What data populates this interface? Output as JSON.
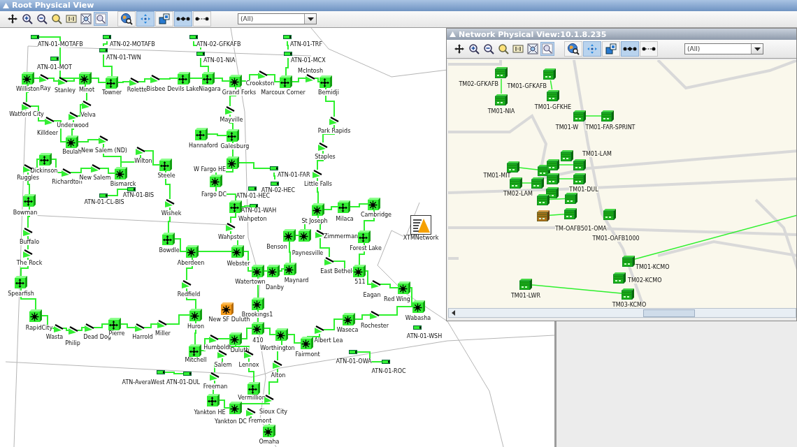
{
  "main_window": {
    "title": "Root Physical View",
    "toolbar": {
      "tools": [
        {
          "kind": "pan",
          "selected": false
        },
        {
          "kind": "zoom-in",
          "selected": false
        },
        {
          "kind": "zoom-out",
          "selected": false
        },
        {
          "kind": "zoom-area",
          "selected": false
        },
        {
          "kind": "actual-size",
          "selected": false
        },
        {
          "kind": "fit",
          "selected": false
        },
        {
          "kind": "zoom-window",
          "selected": true
        },
        {
          "kind": "globe-search",
          "selected": false
        },
        {
          "kind": "move",
          "selected": true
        },
        {
          "kind": "layout",
          "selected": false
        },
        {
          "kind": "bundled-links",
          "selected": true
        },
        {
          "kind": "single-link",
          "selected": false
        }
      ],
      "filter": "(All)"
    },
    "map": {
      "nodes": [
        {
          "kind": "terminal",
          "label": "ATN-01-MOTAFB",
          "alarm": false
        },
        {
          "kind": "terminal",
          "label": "ATN-02-MOTAFB",
          "alarm": false
        },
        {
          "kind": "terminal",
          "label": "ATN-02-GFKAFB",
          "alarm": false
        },
        {
          "kind": "terminal",
          "label": "ATN-01-TRF",
          "alarm": false
        },
        {
          "kind": "terminal",
          "label": "ATN-01-TWN",
          "alarm": false
        },
        {
          "kind": "terminal",
          "label": "ATN-01-NIA",
          "alarm": false
        },
        {
          "kind": "terminal",
          "label": "ATN-01-MCX",
          "alarm": false
        },
        {
          "kind": "terminal",
          "label": "ATN-01-MOT",
          "alarm": false
        },
        {
          "kind": "hub",
          "label": "Williston",
          "alarm": false
        },
        {
          "kind": "radio",
          "label": "Ray",
          "alarm": false
        },
        {
          "kind": "radio",
          "label": "Stanley",
          "alarm": false
        },
        {
          "kind": "hub",
          "label": "Minot",
          "alarm": false
        },
        {
          "kind": "router",
          "label": "Towner",
          "alarm": false
        },
        {
          "kind": "radio",
          "label": "Rolette",
          "alarm": false
        },
        {
          "kind": "radio",
          "label": "Bisbee",
          "alarm": false
        },
        {
          "kind": "router",
          "label": "Devils Lake",
          "alarm": false
        },
        {
          "kind": "router",
          "label": "Niagara",
          "alarm": false
        },
        {
          "kind": "hub",
          "label": "Grand Forks",
          "alarm": false
        },
        {
          "kind": "radio",
          "label": "Crookston",
          "alarm": false
        },
        {
          "kind": "router",
          "label": "Marcoux Corner",
          "alarm": false
        },
        {
          "kind": "radio",
          "label": "McIntosh",
          "alarm": false
        },
        {
          "kind": "router",
          "label": "Bemidji",
          "alarm": false
        },
        {
          "kind": "radio",
          "label": "Watford City",
          "alarm": false
        },
        {
          "kind": "radio",
          "label": "Velva",
          "alarm": false
        },
        {
          "kind": "radio",
          "label": "Underwood",
          "alarm": false
        },
        {
          "kind": "radio",
          "label": "Killdeer",
          "alarm": false
        },
        {
          "kind": "radio",
          "label": "Mayville",
          "alarm": false
        },
        {
          "kind": "radio",
          "label": "Park Rapids",
          "alarm": false
        },
        {
          "kind": "hub",
          "label": "Beulah",
          "alarm": false
        },
        {
          "kind": "radio",
          "label": "New Salem (ND)",
          "alarm": false
        },
        {
          "kind": "router",
          "label": "Hannaford",
          "alarm": false
        },
        {
          "kind": "router",
          "label": "Galesburg",
          "alarm": false
        },
        {
          "kind": "radio",
          "label": "Wilton",
          "alarm": false
        },
        {
          "kind": "radio",
          "label": "Staples",
          "alarm": false
        },
        {
          "kind": "router",
          "label": "Dickinson",
          "alarm": false
        },
        {
          "kind": "hub",
          "label": "W Fargo HE",
          "alarm": false
        },
        {
          "kind": "radio",
          "label": "Ruggles",
          "alarm": false
        },
        {
          "kind": "radio",
          "label": "Richardton",
          "alarm": false
        },
        {
          "kind": "radio",
          "label": "New Salem",
          "alarm": false
        },
        {
          "kind": "hub",
          "label": "Bismarck",
          "alarm": false
        },
        {
          "kind": "router",
          "label": "Steele",
          "alarm": false
        },
        {
          "kind": "terminal",
          "label": "ATN-01-FAR",
          "alarm": false
        },
        {
          "kind": "radio",
          "label": "Little Falls",
          "alarm": false
        },
        {
          "kind": "terminal",
          "label": "ATN-01-BIS",
          "alarm": false
        },
        {
          "kind": "hub",
          "label": "Fargo DC",
          "alarm": false
        },
        {
          "kind": "terminal",
          "label": "ATN-02-HEC",
          "alarm": false
        },
        {
          "kind": "terminal",
          "label": "ATN-01-HEC",
          "alarm": false
        },
        {
          "kind": "terminal",
          "label": "ATN-01-CL-BIS",
          "alarm": false
        },
        {
          "kind": "router",
          "label": "Bowman",
          "alarm": false
        },
        {
          "kind": "radio",
          "label": "Wishek",
          "alarm": false
        },
        {
          "kind": "terminal",
          "label": "ATN-01-WAH",
          "alarm": false
        },
        {
          "kind": "router",
          "label": "Wahpeton",
          "alarm": false
        },
        {
          "kind": "hub",
          "label": "St Joseph",
          "alarm": false
        },
        {
          "kind": "router",
          "label": "Milaca",
          "alarm": false
        },
        {
          "kind": "hub",
          "label": "Cambridge",
          "alarm": false
        },
        {
          "kind": "radio",
          "label": "Buffalo",
          "alarm": false
        },
        {
          "kind": "radio",
          "label": "Wahpster",
          "alarm": false
        },
        {
          "kind": "radio",
          "label": "Zimmerman",
          "alarm": false
        },
        {
          "kind": "network",
          "label": "XTMNetwork",
          "alarm": false
        },
        {
          "kind": "router",
          "label": "Bowdle",
          "alarm": false
        },
        {
          "kind": "hub",
          "label": "Benson",
          "alarm": false
        },
        {
          "kind": "hub",
          "label": "Paynesville",
          "alarm": false
        },
        {
          "kind": "router",
          "label": "Forest Lake",
          "alarm": false
        },
        {
          "kind": "radio",
          "label": "The Rock",
          "alarm": false
        },
        {
          "kind": "hub",
          "label": "Aberdeen",
          "alarm": false
        },
        {
          "kind": "hub",
          "label": "Webster",
          "alarm": false
        },
        {
          "kind": "radio",
          "label": "East Bethel",
          "alarm": false
        },
        {
          "kind": "hub",
          "label": "Watertown",
          "alarm": false
        },
        {
          "kind": "hub",
          "label": "Maynard",
          "alarm": false
        },
        {
          "kind": "hub",
          "label": "Danby",
          "alarm": false
        },
        {
          "kind": "hub",
          "label": "511",
          "alarm": false
        },
        {
          "kind": "router",
          "label": "Spearfish",
          "alarm": false
        },
        {
          "kind": "radio",
          "label": "Redfield",
          "alarm": false
        },
        {
          "kind": "radio",
          "label": "Eagan",
          "alarm": false
        },
        {
          "kind": "hub",
          "label": "Red Wing",
          "alarm": false
        },
        {
          "kind": "hub",
          "label": "Brookings1",
          "alarm": false
        },
        {
          "kind": "hub",
          "label": "New SF Duluth",
          "alarm": true
        },
        {
          "kind": "hub",
          "label": "Wabasha",
          "alarm": false
        },
        {
          "kind": "hub",
          "label": "RapidCity",
          "alarm": false
        },
        {
          "kind": "hub",
          "label": "Huron",
          "alarm": false
        },
        {
          "kind": "hub",
          "label": "Waseca",
          "alarm": false
        },
        {
          "kind": "radio",
          "label": "Rochester",
          "alarm": false
        },
        {
          "kind": "radio",
          "label": "Wasta",
          "alarm": false
        },
        {
          "kind": "radio",
          "label": "Philip",
          "alarm": false
        },
        {
          "kind": "radio",
          "label": "Dead Dog",
          "alarm": false
        },
        {
          "kind": "router",
          "label": "Pierre",
          "alarm": false
        },
        {
          "kind": "radio",
          "label": "Harrold",
          "alarm": false
        },
        {
          "kind": "radio",
          "label": "Miller",
          "alarm": false
        },
        {
          "kind": "hub",
          "label": "410",
          "alarm": false
        },
        {
          "kind": "radio",
          "label": "Albert Lea",
          "alarm": false
        },
        {
          "kind": "terminal",
          "label": "ATN-01-WSH",
          "alarm": false
        },
        {
          "kind": "radio",
          "label": "Humboldt",
          "alarm": false
        },
        {
          "kind": "hub",
          "label": "Duluth",
          "alarm": false
        },
        {
          "kind": "hub",
          "label": "Worthington",
          "alarm": false
        },
        {
          "kind": "hub",
          "label": "Fairmont",
          "alarm": false
        },
        {
          "kind": "router",
          "label": "Mitchell",
          "alarm": false
        },
        {
          "kind": "radio",
          "label": "Salem",
          "alarm": false
        },
        {
          "kind": "radio",
          "label": "Lennox",
          "alarm": false
        },
        {
          "kind": "terminal",
          "label": "ATN-01-OWA",
          "alarm": false
        },
        {
          "kind": "radio",
          "label": "Alton",
          "alarm": false
        },
        {
          "kind": "terminal",
          "label": "ATN-01-ROC",
          "alarm": false
        },
        {
          "kind": "terminal",
          "label": "ATN-AveraWest",
          "alarm": false
        },
        {
          "kind": "terminal",
          "label": "ATN-01-DUL",
          "alarm": false
        },
        {
          "kind": "radio",
          "label": "Freeman",
          "alarm": false
        },
        {
          "kind": "router",
          "label": "Vermillion",
          "alarm": false
        },
        {
          "kind": "router",
          "label": "Yankton HE",
          "alarm": false
        },
        {
          "kind": "radio",
          "label": "Sioux City",
          "alarm": false
        },
        {
          "kind": "hub",
          "label": "Yankton DC",
          "alarm": false
        },
        {
          "kind": "radio",
          "label": "Fremont",
          "alarm": false
        },
        {
          "kind": "hub",
          "label": "Omaha",
          "alarm": false
        }
      ]
    }
  },
  "popup_window": {
    "title": "Network Physical View:10.1.8.235",
    "toolbar": {
      "tools": [
        {
          "kind": "pan",
          "selected": false
        },
        {
          "kind": "zoom-in",
          "selected": false
        },
        {
          "kind": "zoom-out",
          "selected": false
        },
        {
          "kind": "zoom-area",
          "selected": false
        },
        {
          "kind": "actual-size",
          "selected": false
        },
        {
          "kind": "fit",
          "selected": false
        },
        {
          "kind": "zoom-window",
          "selected": true
        },
        {
          "kind": "globe-search",
          "selected": false
        },
        {
          "kind": "move",
          "selected": true
        },
        {
          "kind": "layout",
          "selected": false
        },
        {
          "kind": "bundled-links",
          "selected": true
        },
        {
          "kind": "single-link",
          "selected": false
        }
      ],
      "filter": "(All)"
    },
    "map": {
      "nodes": [
        {
          "label": "TM02-GFKAFB",
          "alarm": false
        },
        {
          "label": "TM01-GFKAFB",
          "alarm": false
        },
        {
          "label": "TM01-NIA",
          "alarm": false
        },
        {
          "label": "TM01-GFKHE",
          "alarm": false
        },
        {
          "label": "TM01-W",
          "alarm": false
        },
        {
          "label": "TM01-FAR-SPRINT",
          "alarm": false
        },
        {
          "label": "TM01-MIT",
          "alarm": false
        },
        {
          "alarm": false
        },
        {
          "alarm": false
        },
        {
          "label": "TM01-LAM",
          "alarm": false
        },
        {
          "alarm": false
        },
        {
          "alarm": false
        },
        {
          "label": "TM02-LAM",
          "alarm": false
        },
        {
          "label": "TM01-DUL",
          "alarm": false
        },
        {
          "alarm": false
        },
        {
          "alarm": false
        },
        {
          "alarm": false
        },
        {
          "alarm": false
        },
        {
          "label": "TM-OAFB501-OMA",
          "alarm": false
        },
        {
          "alarm": true
        },
        {
          "label": "TM01-OAFB1000",
          "alarm": false
        },
        {
          "label": "TM01-KCMO",
          "alarm": false
        },
        {
          "label": "TM02-KCMO",
          "alarm": false
        },
        {
          "label": "TM03-KCMO",
          "alarm": false
        },
        {
          "label": "TM01-LWR",
          "alarm": false
        }
      ]
    }
  }
}
